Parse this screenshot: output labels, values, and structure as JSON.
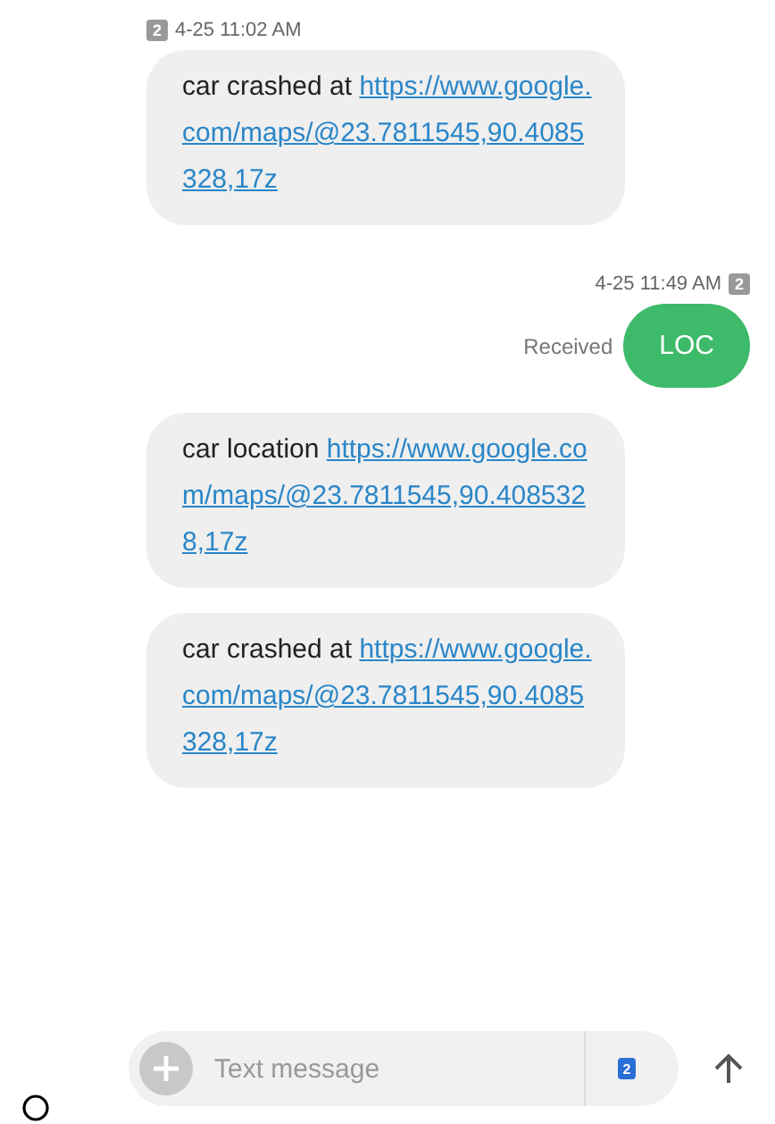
{
  "messages": [
    {
      "kind": "incoming",
      "sim": "2",
      "time": "4-25 11:02 AM",
      "text": "car crashed at ",
      "link": "https://www.google.com/maps/@23.7811545,90.4085328,17z"
    },
    {
      "kind": "outgoing",
      "sim": "2",
      "time": "4-25 11:49 AM",
      "status": "Received",
      "text": "LOC"
    },
    {
      "kind": "incoming",
      "text": "car location ",
      "link": "https://www.google.com/maps/@23.7811545,90.4085328,17z"
    },
    {
      "kind": "incoming",
      "text": "car crashed at ",
      "link": "https://www.google.com/maps/@23.7811545,90.4085328,17z"
    }
  ],
  "composer": {
    "placeholder": "Text message",
    "sim": "2"
  }
}
